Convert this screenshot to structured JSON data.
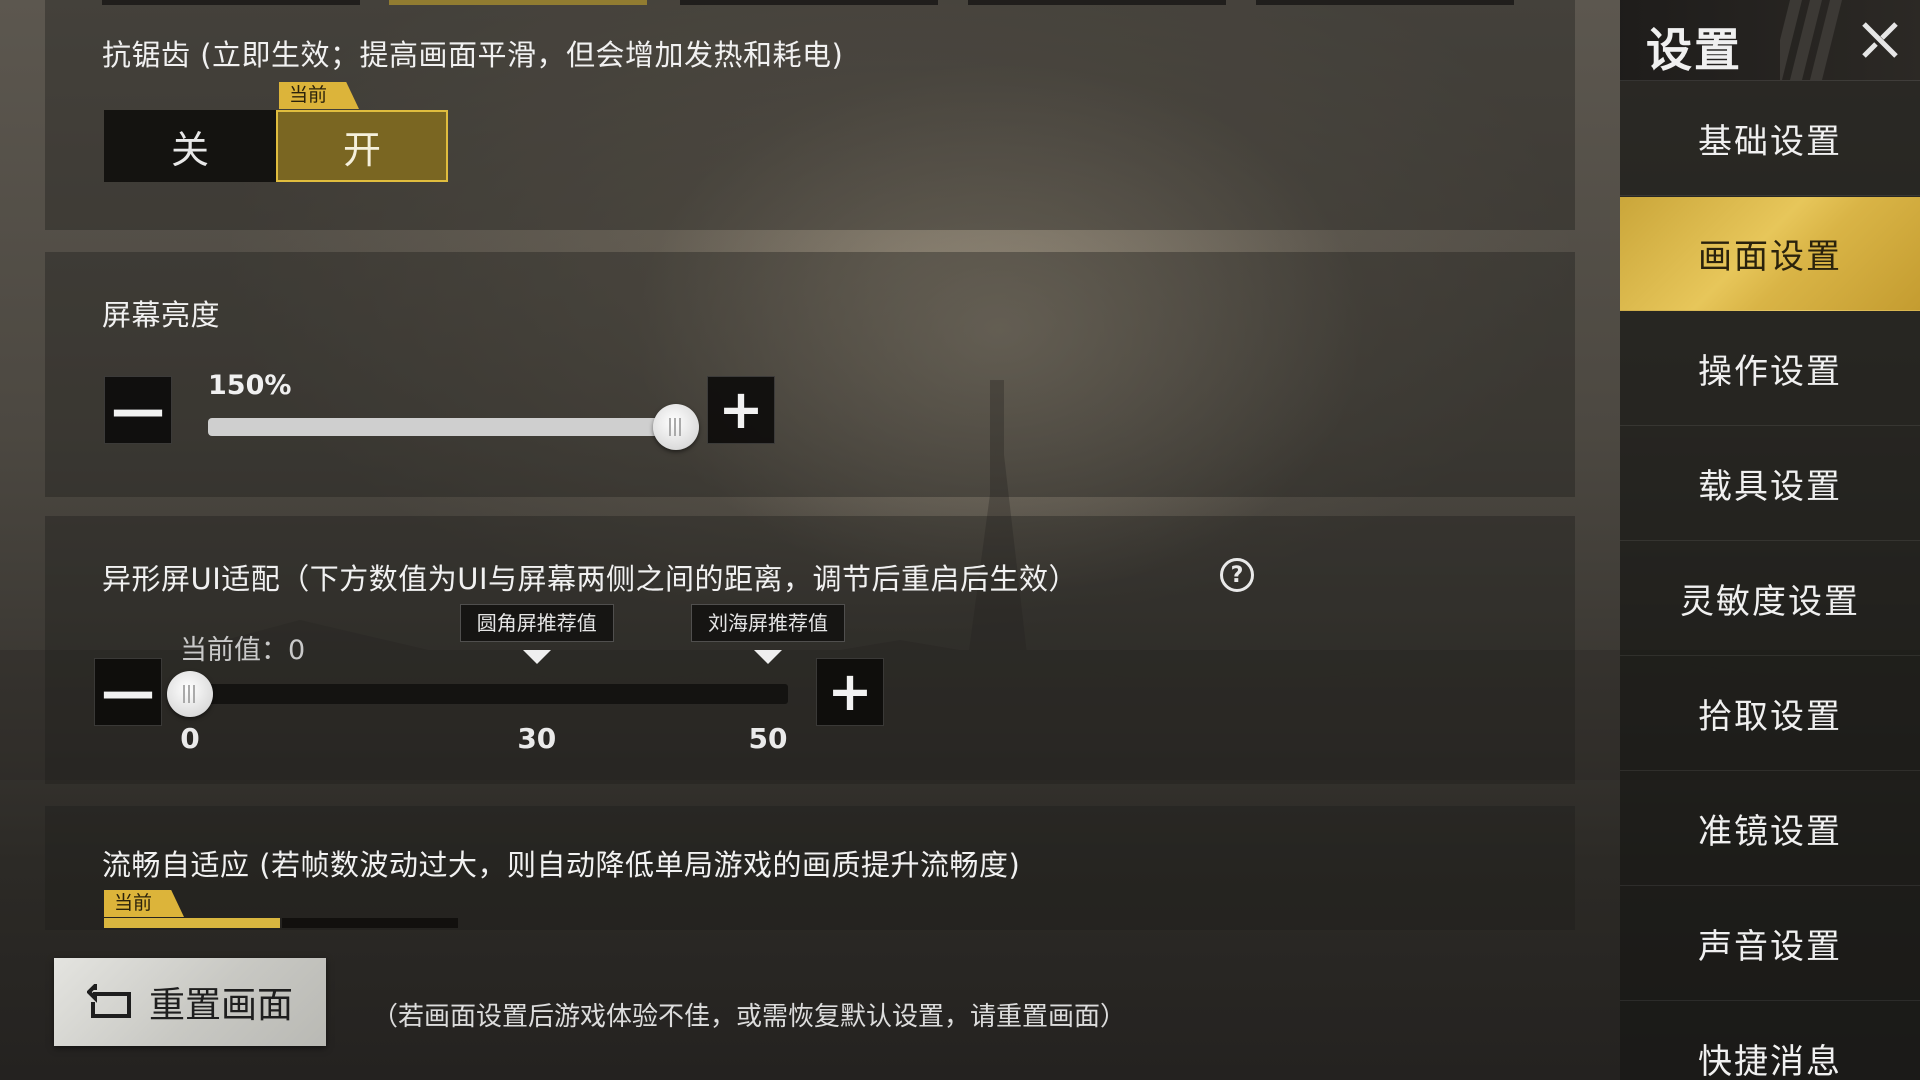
{
  "anti_aliasing": {
    "title": "抗锯齿 (立即生效；提高画面平滑，但会增加发热和耗电)",
    "current_tag": "当前",
    "options": [
      "关",
      "开"
    ],
    "selected": "开"
  },
  "brightness": {
    "title": "屏幕亮度",
    "value_text": "150%",
    "level_fraction": 1.0,
    "minus_symbol": "—",
    "plus_symbol": "+"
  },
  "notch_ui": {
    "title": "异形屏UI适配（下方数值为UI与屏幕两侧之间的距离，调节后重启后生效）",
    "help_symbol": "?",
    "current_value_text": "当前值：0",
    "value": 0,
    "min": 0,
    "max": 50,
    "markers": [
      {
        "label": "圆角屏推荐值",
        "value": 30
      },
      {
        "label": "刘海屏推荐值",
        "value": 50
      }
    ],
    "tick_labels": [
      "0",
      "30",
      "50"
    ],
    "minus_symbol": "—",
    "plus_symbol": "+"
  },
  "smooth_adaptive": {
    "title": "流畅自适应 (若帧数波动过大，则自动降低单局游戏的画质提升流畅度)",
    "current_tag": "当前"
  },
  "reset": {
    "button_label": "重置画面",
    "hint": "（若画面设置后游戏体验不佳，或需恢复默认设置，请重置画面）"
  },
  "sidebar": {
    "title": "设置",
    "items": [
      {
        "label": "基础设置"
      },
      {
        "label": "画面设置"
      },
      {
        "label": "操作设置"
      },
      {
        "label": "载具设置"
      },
      {
        "label": "灵敏度设置"
      },
      {
        "label": "拾取设置"
      },
      {
        "label": "准镜设置"
      },
      {
        "label": "声音设置"
      },
      {
        "label": "快捷消息"
      }
    ],
    "active_index": 1
  },
  "colors": {
    "accent_gold": "#dcb43a",
    "active_toggle_bg": "#7a6622",
    "panel_bg": "#1e1c19"
  }
}
